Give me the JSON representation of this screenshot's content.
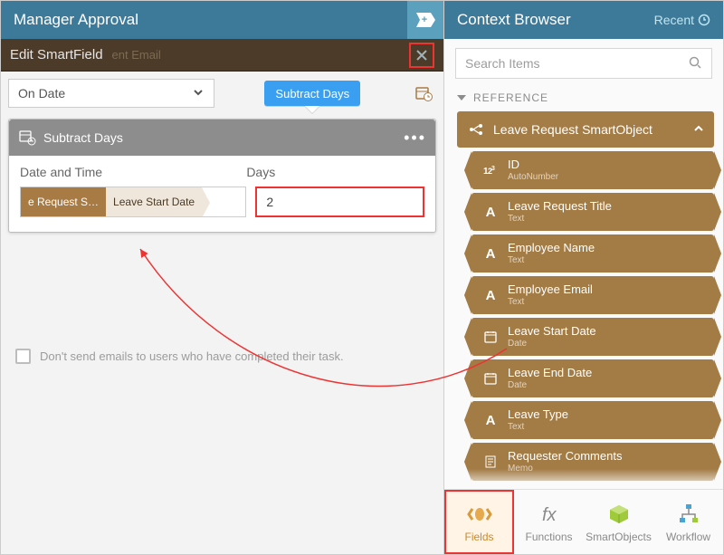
{
  "left": {
    "header_title": "Manager Approval",
    "edit_title": "Edit SmartField",
    "faded_sublabel": "ent Email",
    "dropdown_label": "On Date",
    "chip_label": "Subtract Days",
    "card_title": "Subtract Days",
    "label_datetime": "Date and Time",
    "label_days": "Days",
    "token_source": "e Request S…",
    "token_field": "Leave Start Date",
    "days_value": "2",
    "checkbox_label": "Don't send emails to users who have completed their task."
  },
  "right": {
    "header_title": "Context Browser",
    "recent_label": "Recent",
    "search_placeholder": "Search Items",
    "section_label": "REFERENCE",
    "root_label": "Leave Request SmartObject",
    "items": [
      {
        "icon": "id",
        "label": "ID",
        "type": "AutoNumber"
      },
      {
        "icon": "A",
        "label": "Leave Request Title",
        "type": "Text"
      },
      {
        "icon": "A",
        "label": "Employee Name",
        "type": "Text"
      },
      {
        "icon": "A",
        "label": "Employee Email",
        "type": "Text"
      },
      {
        "icon": "cal",
        "label": "Leave Start Date",
        "type": "Date"
      },
      {
        "icon": "cal",
        "label": "Leave End Date",
        "type": "Date"
      },
      {
        "icon": "A",
        "label": "Leave Type",
        "type": "Text"
      },
      {
        "icon": "memo",
        "label": "Requester Comments",
        "type": "Memo"
      }
    ],
    "tabs": {
      "fields": "Fields",
      "functions": "Functions",
      "smartobjects": "SmartObjects",
      "workflow": "Workflow"
    }
  },
  "colors": {
    "header": "#3d7a99",
    "accent_blue": "#3a9ff1",
    "brown": "#a37b45",
    "highlight": "#e33"
  }
}
